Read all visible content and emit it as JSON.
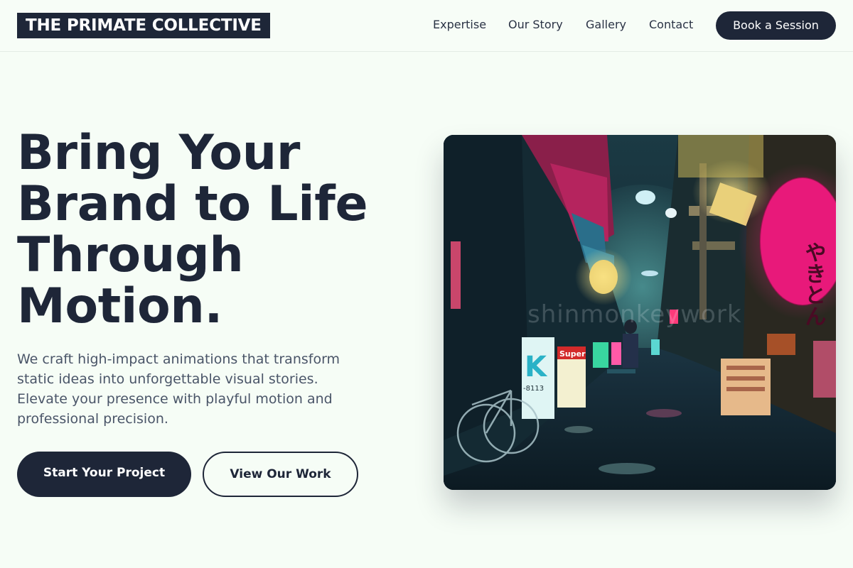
{
  "brand": {
    "name": "THE PRIMATE COLLECTIVE"
  },
  "nav": {
    "links": [
      "Expertise",
      "Our Story",
      "Gallery",
      "Contact"
    ],
    "cta": "Book a Session"
  },
  "hero": {
    "headline": [
      "Bring Your",
      "Brand to Life",
      "Through",
      "Motion."
    ],
    "description": [
      "We craft high-impact animations that transform",
      "static ideas into unforgettable visual stories.",
      "Elevate your presence with playful motion and",
      "professional precision."
    ],
    "primary_button": "Start Your Project",
    "secondary_button": "View Our Work",
    "image": {
      "watermark": "shinmonkeywork",
      "sign_lantern": "やきとん",
      "sign_super": "Super",
      "sign_phone": "-8113"
    }
  },
  "colors": {
    "background": "#f6fdf6",
    "dark": "#1e2638",
    "text_muted": "#4a5568",
    "neon_pink": "#e8197a"
  }
}
